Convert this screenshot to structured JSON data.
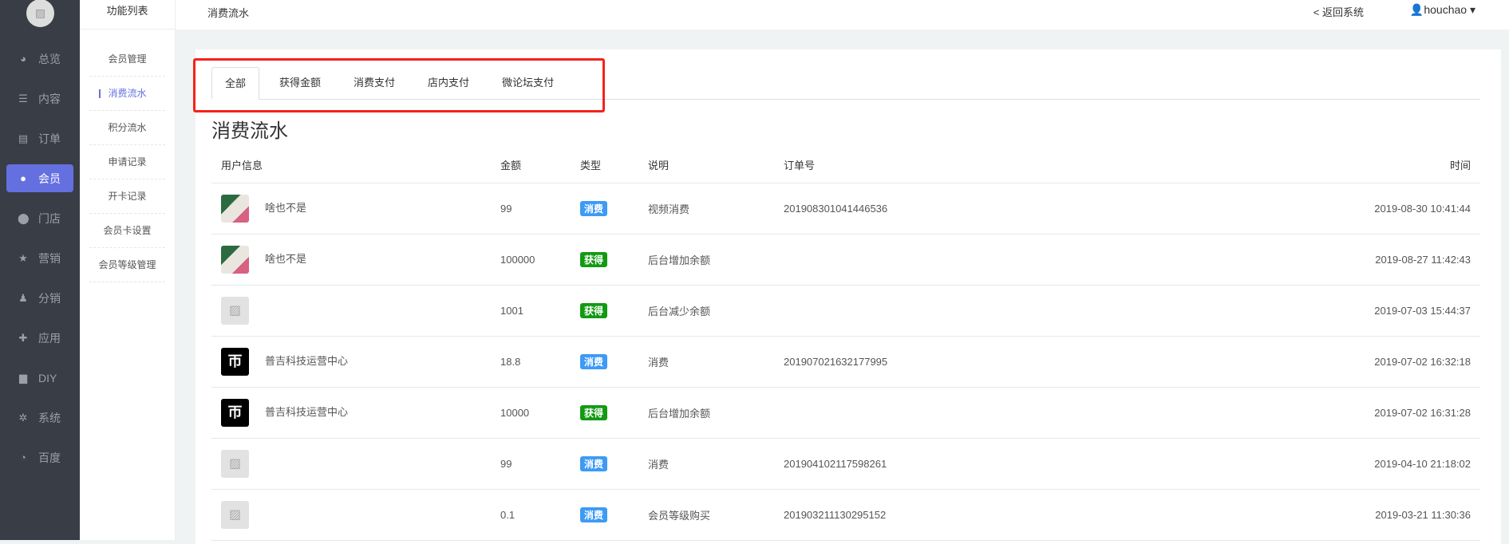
{
  "sidebar": {
    "items": [
      {
        "label": "总览",
        "icon": "pie-chart-icon",
        "glyph": "◕"
      },
      {
        "label": "内容",
        "icon": "list-icon",
        "glyph": "☰"
      },
      {
        "label": "订单",
        "icon": "document-icon",
        "glyph": "▤"
      },
      {
        "label": "会员",
        "icon": "user-icon",
        "glyph": "●",
        "active": true
      },
      {
        "label": "门店",
        "icon": "map-pin-icon",
        "glyph": "⬤"
      },
      {
        "label": "营销",
        "icon": "star-icon",
        "glyph": "★"
      },
      {
        "label": "分销",
        "icon": "users-icon",
        "glyph": "♟"
      },
      {
        "label": "应用",
        "icon": "puzzle-icon",
        "glyph": "✚"
      },
      {
        "label": "DIY",
        "icon": "layout-icon",
        "glyph": "▆"
      },
      {
        "label": "系统",
        "icon": "gear-icon",
        "glyph": "✲"
      },
      {
        "label": "百度",
        "icon": "compass-icon",
        "glyph": "◔"
      }
    ]
  },
  "submenu": {
    "title": "功能列表",
    "items": [
      "会员管理",
      "消费流水",
      "积分流水",
      "申请记录",
      "开卡记录",
      "会员卡设置",
      "会员等级管理"
    ],
    "active": 1
  },
  "header": {
    "title": "消费流水",
    "back": "< 返回系统",
    "user": "houchao ▾"
  },
  "tabs": [
    "全部",
    "获得金额",
    "消费支付",
    "店内支付",
    "微论坛支付"
  ],
  "page_title": "消费流水",
  "colors": {
    "consume": "#3d9af5",
    "gain": "#129a12",
    "accent": "#6470e0"
  },
  "table": {
    "headers": [
      "用户信息",
      "金额",
      "类型",
      "说明",
      "订单号",
      "时间"
    ],
    "rows": [
      {
        "avatar": "photo",
        "name": "啥也不是",
        "amount": "99",
        "type": "消费",
        "kind": "consume",
        "desc": "视频消费",
        "order": "201908301041446536",
        "time": "2019-08-30 10:41:44"
      },
      {
        "avatar": "photo",
        "name": "啥也不是",
        "amount": "100000",
        "type": "获得",
        "kind": "gain",
        "desc": "后台增加余额",
        "order": "",
        "time": "2019-08-27 11:42:43"
      },
      {
        "avatar": "placeholder",
        "name": "",
        "amount": "1001",
        "type": "获得",
        "kind": "gain",
        "desc": "后台减少余额",
        "order": "",
        "time": "2019-07-03 15:44:37"
      },
      {
        "avatar": "logo",
        "name": "普吉科技运营中心",
        "amount": "18.8",
        "type": "消费",
        "kind": "consume",
        "desc": "消费",
        "order": "201907021632177995",
        "time": "2019-07-02 16:32:18"
      },
      {
        "avatar": "logo",
        "name": "普吉科技运营中心",
        "amount": "10000",
        "type": "获得",
        "kind": "gain",
        "desc": "后台增加余额",
        "order": "",
        "time": "2019-07-02 16:31:28"
      },
      {
        "avatar": "placeholder",
        "name": "",
        "amount": "99",
        "type": "消费",
        "kind": "consume",
        "desc": "消费",
        "order": "201904102117598261",
        "time": "2019-04-10 21:18:02"
      },
      {
        "avatar": "placeholder",
        "name": "",
        "amount": "0.1",
        "type": "消费",
        "kind": "consume",
        "desc": "会员等级购买",
        "order": "201903211130295152",
        "time": "2019-03-21 11:30:36"
      }
    ]
  }
}
